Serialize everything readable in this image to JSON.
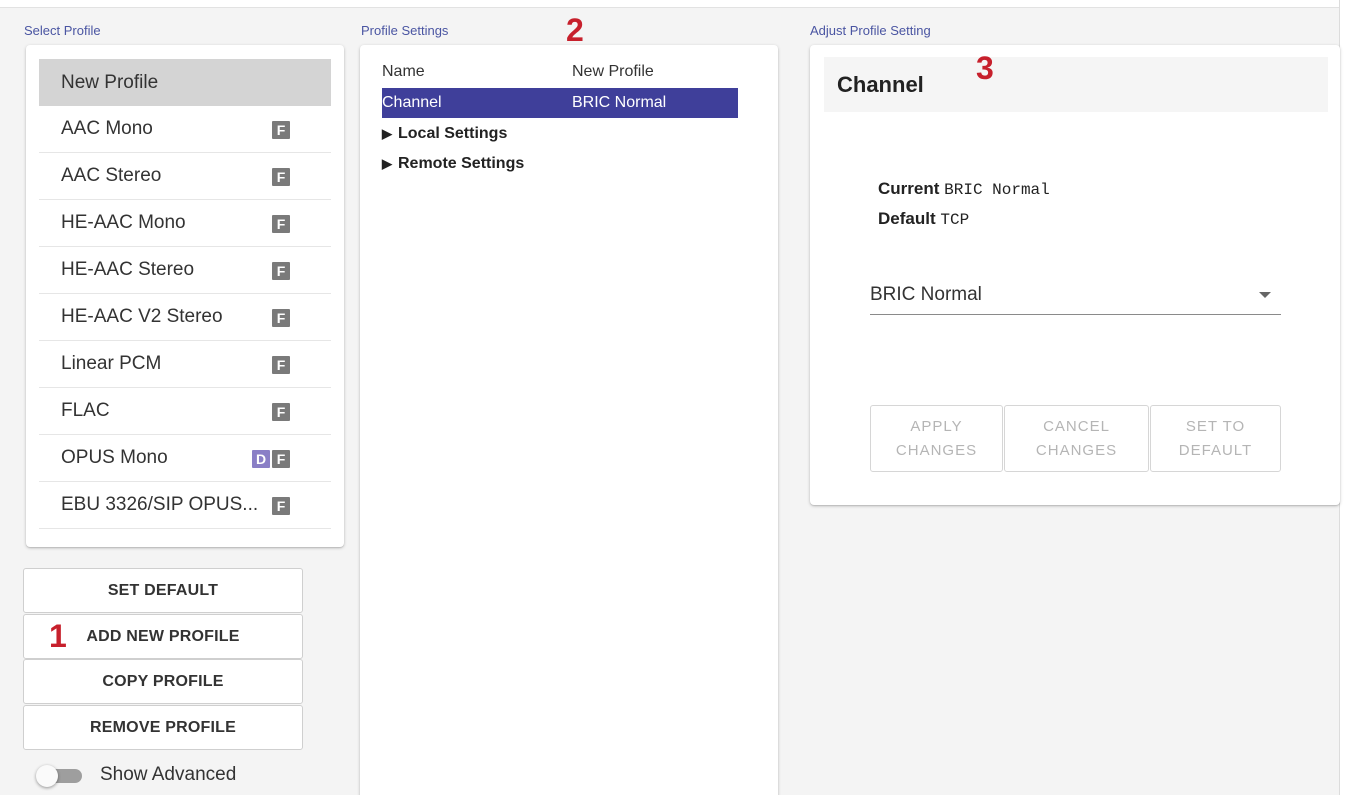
{
  "sections": {
    "select_profile": "Select Profile",
    "profile_settings": "Profile Settings",
    "adjust_profile_setting": "Adjust Profile Setting"
  },
  "profiles": [
    {
      "label": "New Profile",
      "selected": true,
      "badges": []
    },
    {
      "label": "AAC Mono",
      "badges": [
        "F"
      ]
    },
    {
      "label": "AAC Stereo",
      "badges": [
        "F"
      ]
    },
    {
      "label": "HE-AAC Mono",
      "badges": [
        "F"
      ]
    },
    {
      "label": "HE-AAC Stereo",
      "badges": [
        "F"
      ]
    },
    {
      "label": "HE-AAC V2 Stereo",
      "badges": [
        "F"
      ]
    },
    {
      "label": "Linear PCM",
      "badges": [
        "F"
      ]
    },
    {
      "label": "FLAC",
      "badges": [
        "F"
      ]
    },
    {
      "label": "OPUS Mono",
      "badges": [
        "D",
        "F"
      ]
    },
    {
      "label": "EBU 3326/SIP OPUS...",
      "badges": [
        "F"
      ]
    }
  ],
  "buttons": {
    "set_default": "SET DEFAULT",
    "add_new_profile": "ADD NEW PROFILE",
    "copy_profile": "COPY PROFILE",
    "remove_profile": "REMOVE PROFILE"
  },
  "show_advanced": {
    "label": "Show Advanced",
    "on": false
  },
  "settings": {
    "name_key": "Name",
    "name_value": "New Profile",
    "channel_key": "Channel",
    "channel_value": "BRIC Normal",
    "local_settings": "Local Settings",
    "remote_settings": "Remote Settings"
  },
  "adjust": {
    "title": "Channel",
    "current_label": "Current",
    "current_value": "BRIC Normal",
    "default_label": "Default",
    "default_value": "TCP",
    "select_value": "BRIC Normal",
    "apply_changes": "APPLY\nCHANGES",
    "cancel_changes": "CANCEL\nCHANGES",
    "set_to_default": "SET TO\nDEFAULT"
  },
  "callouts": [
    "1",
    "2",
    "3"
  ],
  "colors": {
    "accent": "#3f3f9a",
    "section_label": "#4a55a2",
    "callout": "#c7202c",
    "badge_f": "#7a7a7a",
    "badge_d": "#8a7fc6"
  }
}
